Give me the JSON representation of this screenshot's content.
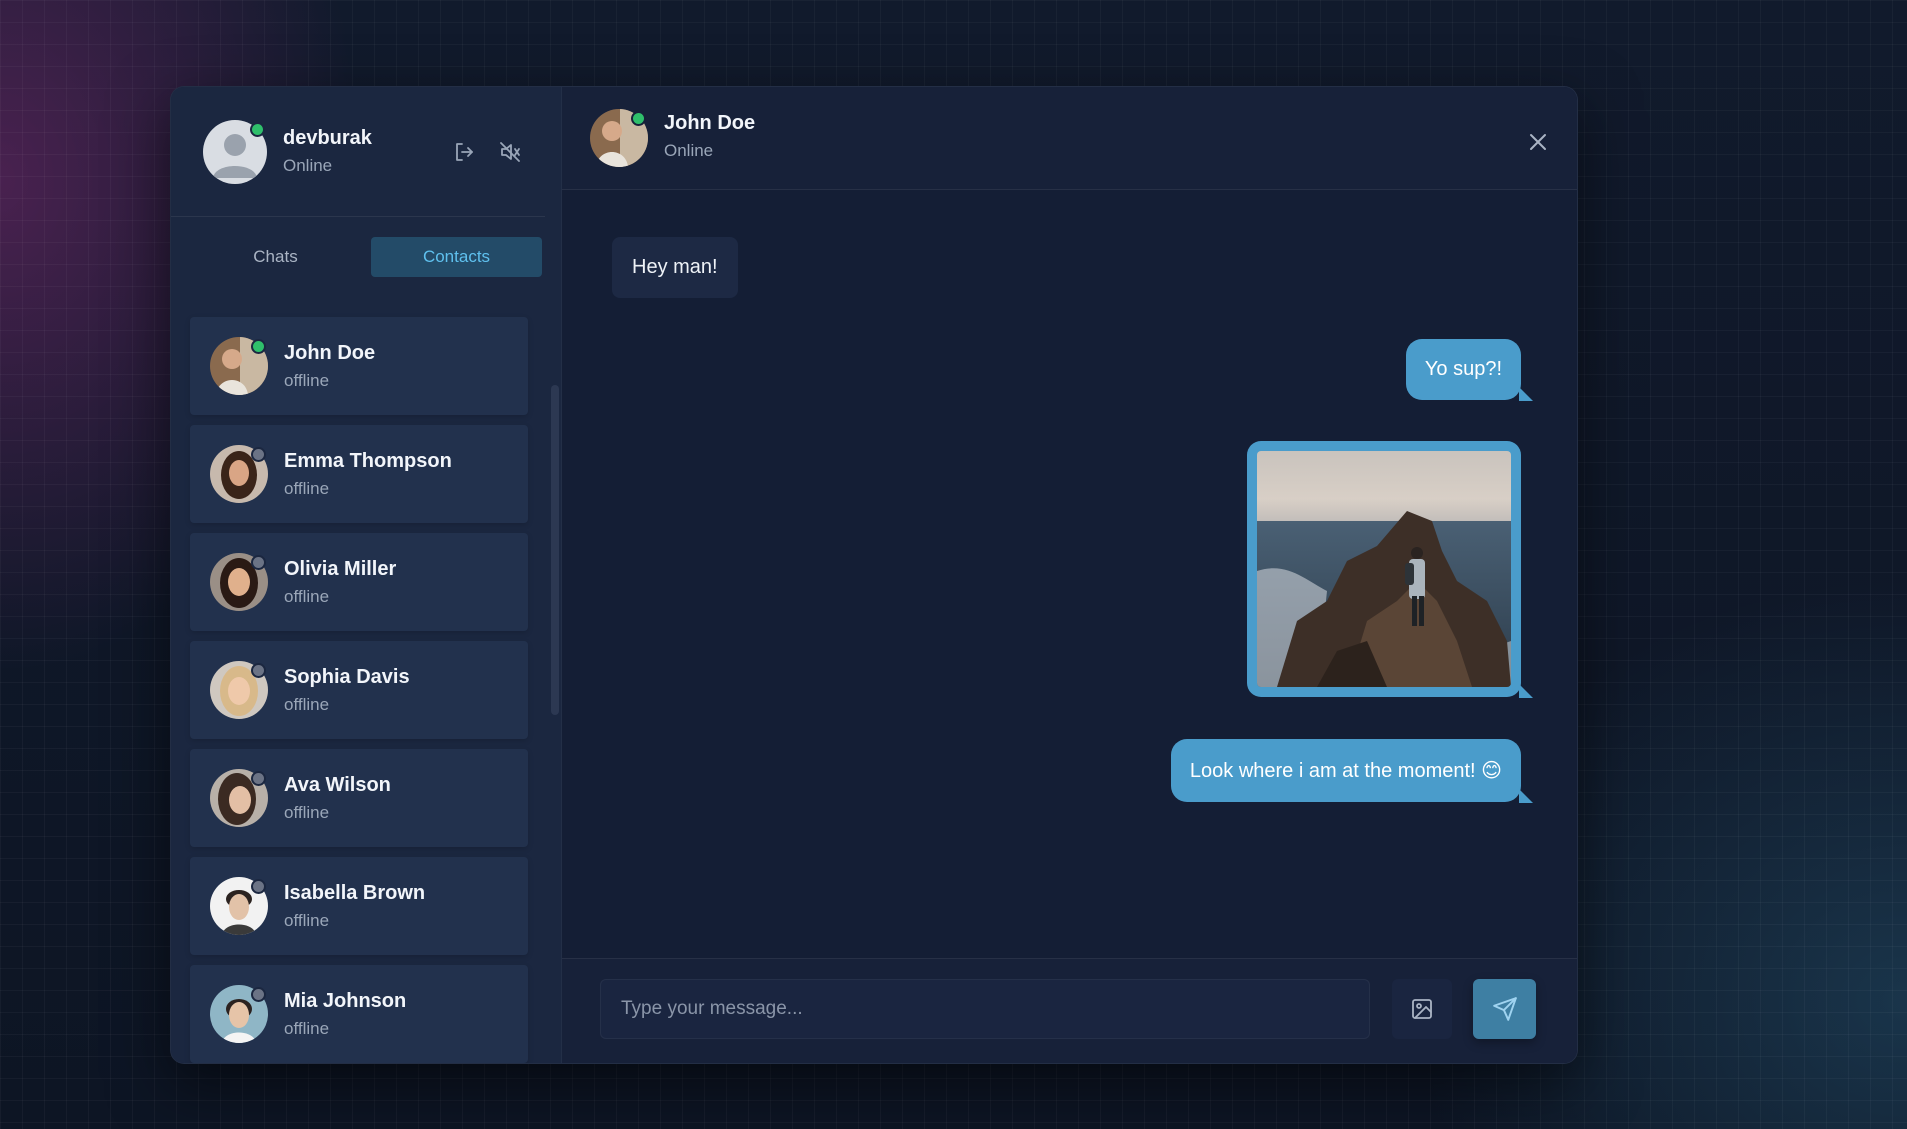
{
  "profile": {
    "username": "devburak",
    "status": "Online"
  },
  "tabs": [
    {
      "label": "Chats",
      "active": false
    },
    {
      "label": "Contacts",
      "active": true
    }
  ],
  "contacts": [
    {
      "name": "John Doe",
      "status": "offline"
    },
    {
      "name": "Emma Thompson",
      "status": "offline"
    },
    {
      "name": "Olivia Miller",
      "status": "offline"
    },
    {
      "name": "Sophia Davis",
      "status": "offline"
    },
    {
      "name": "Ava Wilson",
      "status": "offline"
    },
    {
      "name": "Isabella Brown",
      "status": "offline"
    },
    {
      "name": "Mia Johnson",
      "status": "offline"
    }
  ],
  "chat": {
    "contact_name": "John Doe",
    "contact_status": "Online",
    "messages": [
      {
        "direction": "in",
        "type": "text",
        "text": "Hey man!"
      },
      {
        "direction": "out",
        "type": "text",
        "text": "Yo sup?!"
      },
      {
        "direction": "out",
        "type": "image",
        "alt": "photo"
      },
      {
        "direction": "out",
        "type": "text",
        "text": "Look where i am at the moment! 😊"
      }
    ]
  },
  "composer": {
    "placeholder": "Type your message..."
  },
  "icons": {
    "logout": "logout-icon",
    "mute": "volume-off-icon",
    "close": "close-icon",
    "image": "image-icon",
    "send": "send-icon"
  },
  "colors": {
    "accent": "#4a9ccb",
    "active_tab_bg": "#234b68",
    "active_tab_text": "#5fc0ee",
    "online": "#2fbf6b"
  }
}
